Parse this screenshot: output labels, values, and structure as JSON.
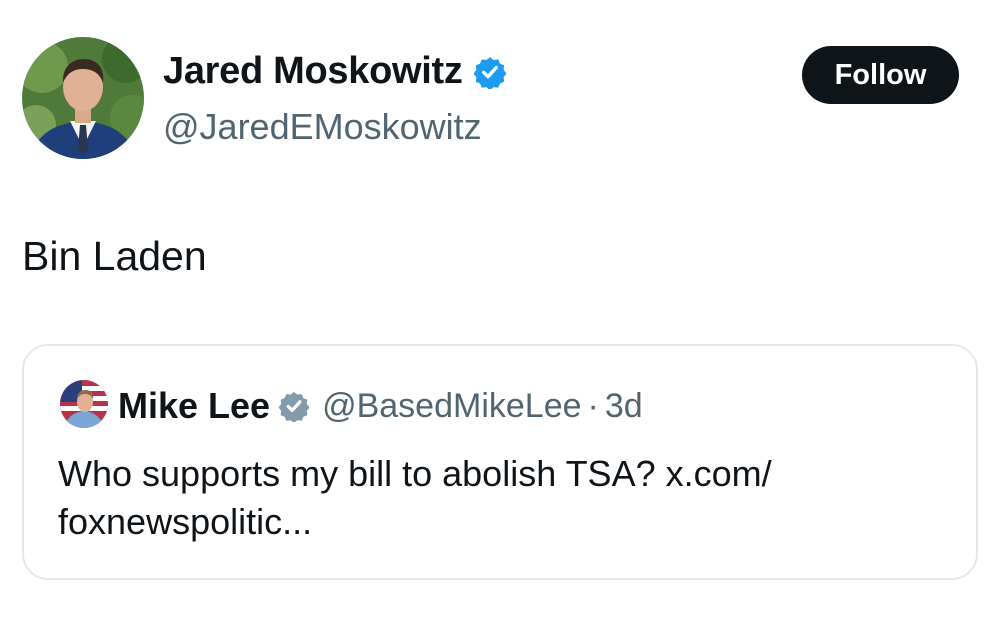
{
  "post": {
    "author": {
      "name": "Jared Moskowitz",
      "handle": "@JaredEMoskowitz",
      "verified": true,
      "verified_color": "#1d9bf0",
      "avatar_icon": "profile-photo"
    },
    "follow_label": "Follow",
    "text": "Bin Laden"
  },
  "quote": {
    "author": {
      "name": "Mike Lee",
      "handle": "@BasedMikeLee",
      "verified": true,
      "verified_color": "#829aab",
      "avatar_icon": "profile-photo"
    },
    "separator": "·",
    "time": "3d",
    "text_lines": [
      "Who supports my bill to abolish TSA? x.com/",
      "foxnewspolitic..."
    ]
  }
}
